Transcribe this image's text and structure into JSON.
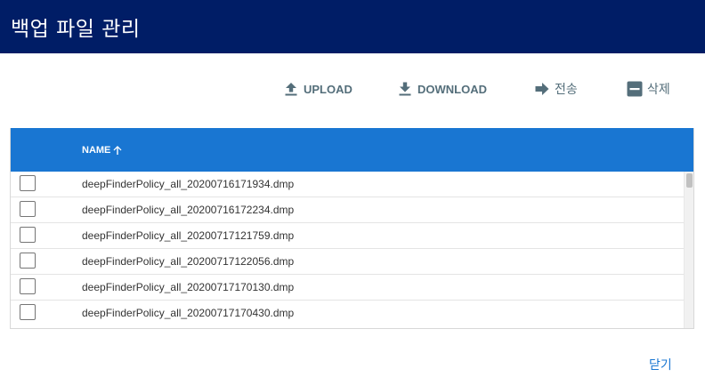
{
  "header": {
    "title": "백업 파일 관리",
    "bg_color": "#001d66"
  },
  "toolbar": {
    "upload_label": "UPLOAD",
    "download_label": "DOWNLOAD",
    "send_label": "전송",
    "delete_label": "삭제",
    "icon_color": "#546e7a"
  },
  "table": {
    "header_bg": "#1976d2",
    "columns": [
      {
        "label": "NAME",
        "sort": "ascending"
      }
    ],
    "rows": [
      {
        "name": "deepFinderPolicy_all_20200716171934.dmp",
        "checked": false
      },
      {
        "name": "deepFinderPolicy_all_20200716172234.dmp",
        "checked": false
      },
      {
        "name": "deepFinderPolicy_all_20200717121759.dmp",
        "checked": false
      },
      {
        "name": "deepFinderPolicy_all_20200717122056.dmp",
        "checked": false
      },
      {
        "name": "deepFinderPolicy_all_20200717170130.dmp",
        "checked": false
      },
      {
        "name": "deepFinderPolicy_all_20200717170430.dmp",
        "checked": false
      }
    ]
  },
  "footer": {
    "close_label": "닫기",
    "accent_color": "#1976d2"
  }
}
